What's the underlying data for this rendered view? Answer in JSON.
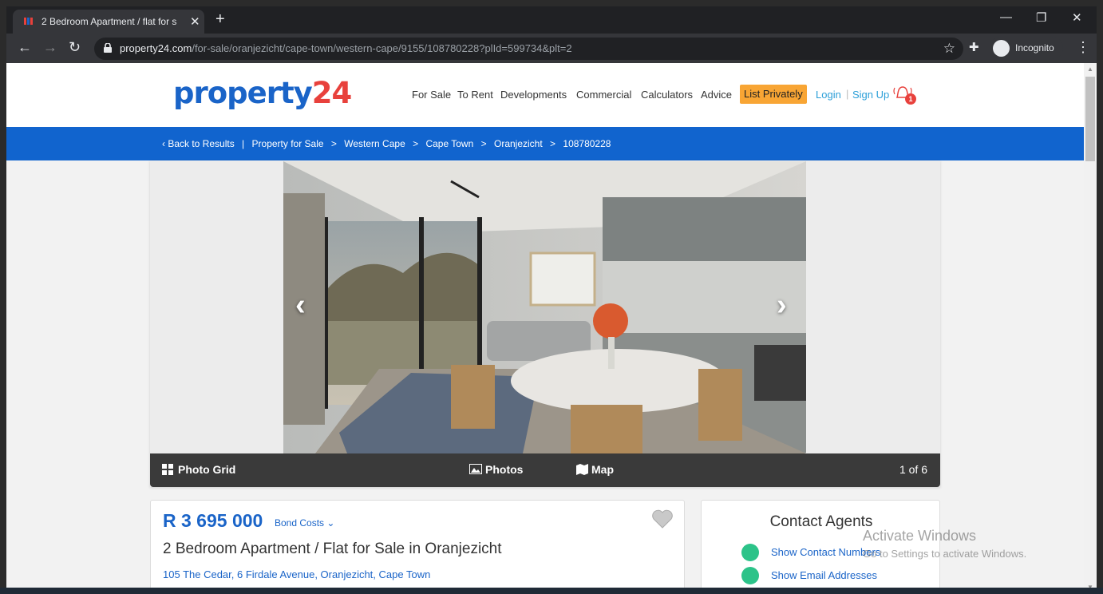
{
  "browser": {
    "tab_title": "2 Bedroom Apartment / flat for s",
    "tab_close": "✕",
    "new_tab": "+",
    "url_domain": "property24.com",
    "url_path": "/for-sale/oranjezicht/cape-town/western-cape/9155/108780228?plId=599734&plt=2",
    "incognito_label": "Incognito"
  },
  "header": {
    "logo_main": "property",
    "logo_num": "24",
    "nav": [
      "For Sale",
      "To Rent",
      "Developments",
      "Commercial",
      "Calculators",
      "Advice"
    ],
    "list_privately": "List Privately",
    "login": "Login",
    "signup": "Sign Up",
    "notification_count": "1"
  },
  "breadcrumb": {
    "back": "‹ Back to Results",
    "items": [
      "Property for Sale",
      "Western Cape",
      "Cape Town",
      "Oranjezicht",
      "108780228"
    ]
  },
  "gallery": {
    "photo_grid": "Photo Grid",
    "photos": "Photos",
    "map": "Map",
    "counter": "1 of 6"
  },
  "listing": {
    "price": "R 3 695 000",
    "bond_costs": "Bond Costs ⌄",
    "title": "2 Bedroom Apartment / Flat for Sale in Oranjezicht",
    "address": "105 The Cedar, 6 Firdale Avenue, Oranjezicht, Cape Town"
  },
  "contact": {
    "heading": "Contact Agents",
    "show_numbers": "Show Contact Numbers",
    "show_emails": "Show Email Addresses"
  },
  "watermark": {
    "line1": "Activate Windows",
    "line2": "Go to Settings to activate Windows."
  }
}
